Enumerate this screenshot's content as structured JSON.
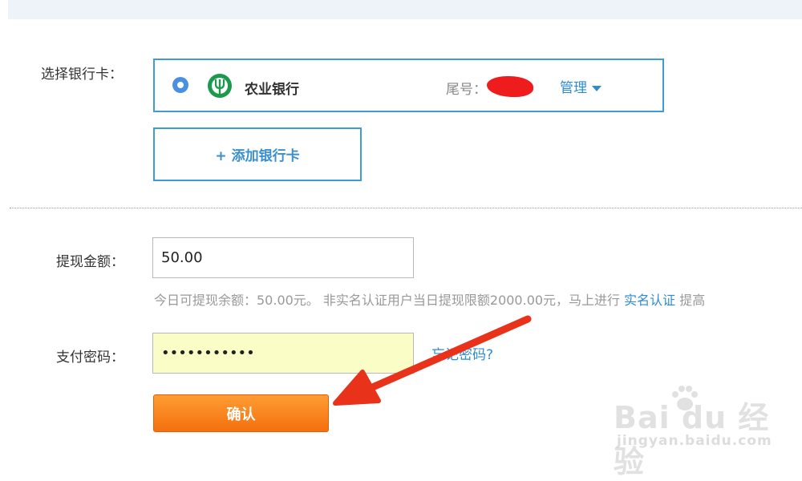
{
  "bank_section": {
    "label": "选择银行卡：",
    "selected_bank": {
      "name": "农业银行",
      "tail_label": "尾号：",
      "manage_label": "管理"
    },
    "add_card_label": "+ 添加银行卡"
  },
  "withdraw": {
    "label": "提现金额：",
    "amount_value": "50.00",
    "hint_text": "今日可提现余额：50.00元。 非实名认证用户当日提现限额2000.00元，马上进行 ",
    "hint_link": "实名认证",
    "hint_tail": " 提高"
  },
  "payment": {
    "label": "支付密码：",
    "password_value": "•••••••••••",
    "forgot_label": "忘记密码?"
  },
  "confirm_label": "确认",
  "watermark": {
    "text": "Bai du 经验",
    "sub": "jingyan.baidu.com"
  },
  "colors": {
    "accent": "#3e9bd6",
    "link": "#2f8bd0",
    "confirm": "#f4700e",
    "password_bg": "#fafdc6",
    "annotation_arrow": "#e8321a"
  }
}
